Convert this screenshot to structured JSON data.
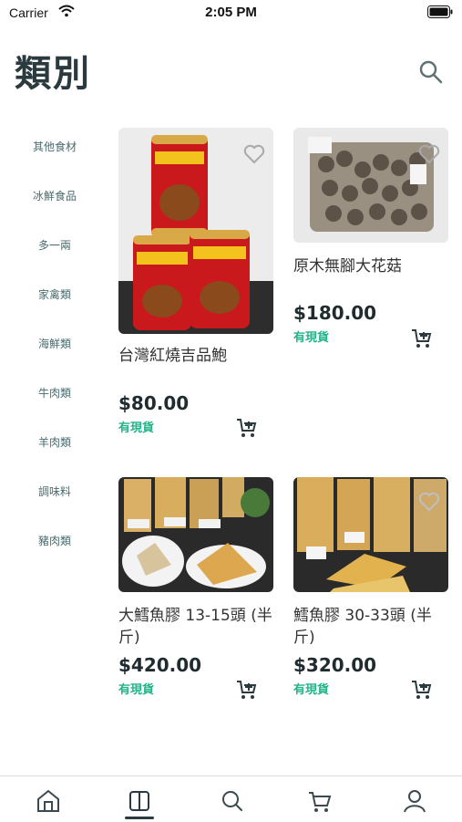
{
  "status_bar": {
    "carrier": "Carrier",
    "time": "2:05 PM"
  },
  "header": {
    "title": "類別",
    "search_icon": "search-icon"
  },
  "categories": [
    {
      "label": "其他食材"
    },
    {
      "label": "冰鮮食品"
    },
    {
      "label": "多一兩"
    },
    {
      "label": "家禽類"
    },
    {
      "label": "海鮮類"
    },
    {
      "label": "牛肉類"
    },
    {
      "label": "羊肉類"
    },
    {
      "label": "調味料"
    },
    {
      "label": "豬肉類"
    }
  ],
  "products": [
    {
      "name": "台灣紅燒吉品鮑",
      "price": "$80.00",
      "stock": "有現貨"
    },
    {
      "name": "原木無腳大花菇",
      "price": "$180.00",
      "stock": "有現貨"
    },
    {
      "name": "大鱈魚膠 13-15頭 (半斤)",
      "price": "$420.00",
      "stock": "有現貨"
    },
    {
      "name": "鱈魚膠 30-33頭 (半斤)",
      "price": "$320.00",
      "stock": "有現貨"
    }
  ],
  "tabbar": {
    "items": [
      "home-icon",
      "catalog-icon",
      "search-icon",
      "cart-icon",
      "profile-icon"
    ],
    "active": "catalog-icon"
  },
  "colors": {
    "accent": "#23b38a",
    "title": "#2b3a3f",
    "category_text": "#4a6b70"
  }
}
